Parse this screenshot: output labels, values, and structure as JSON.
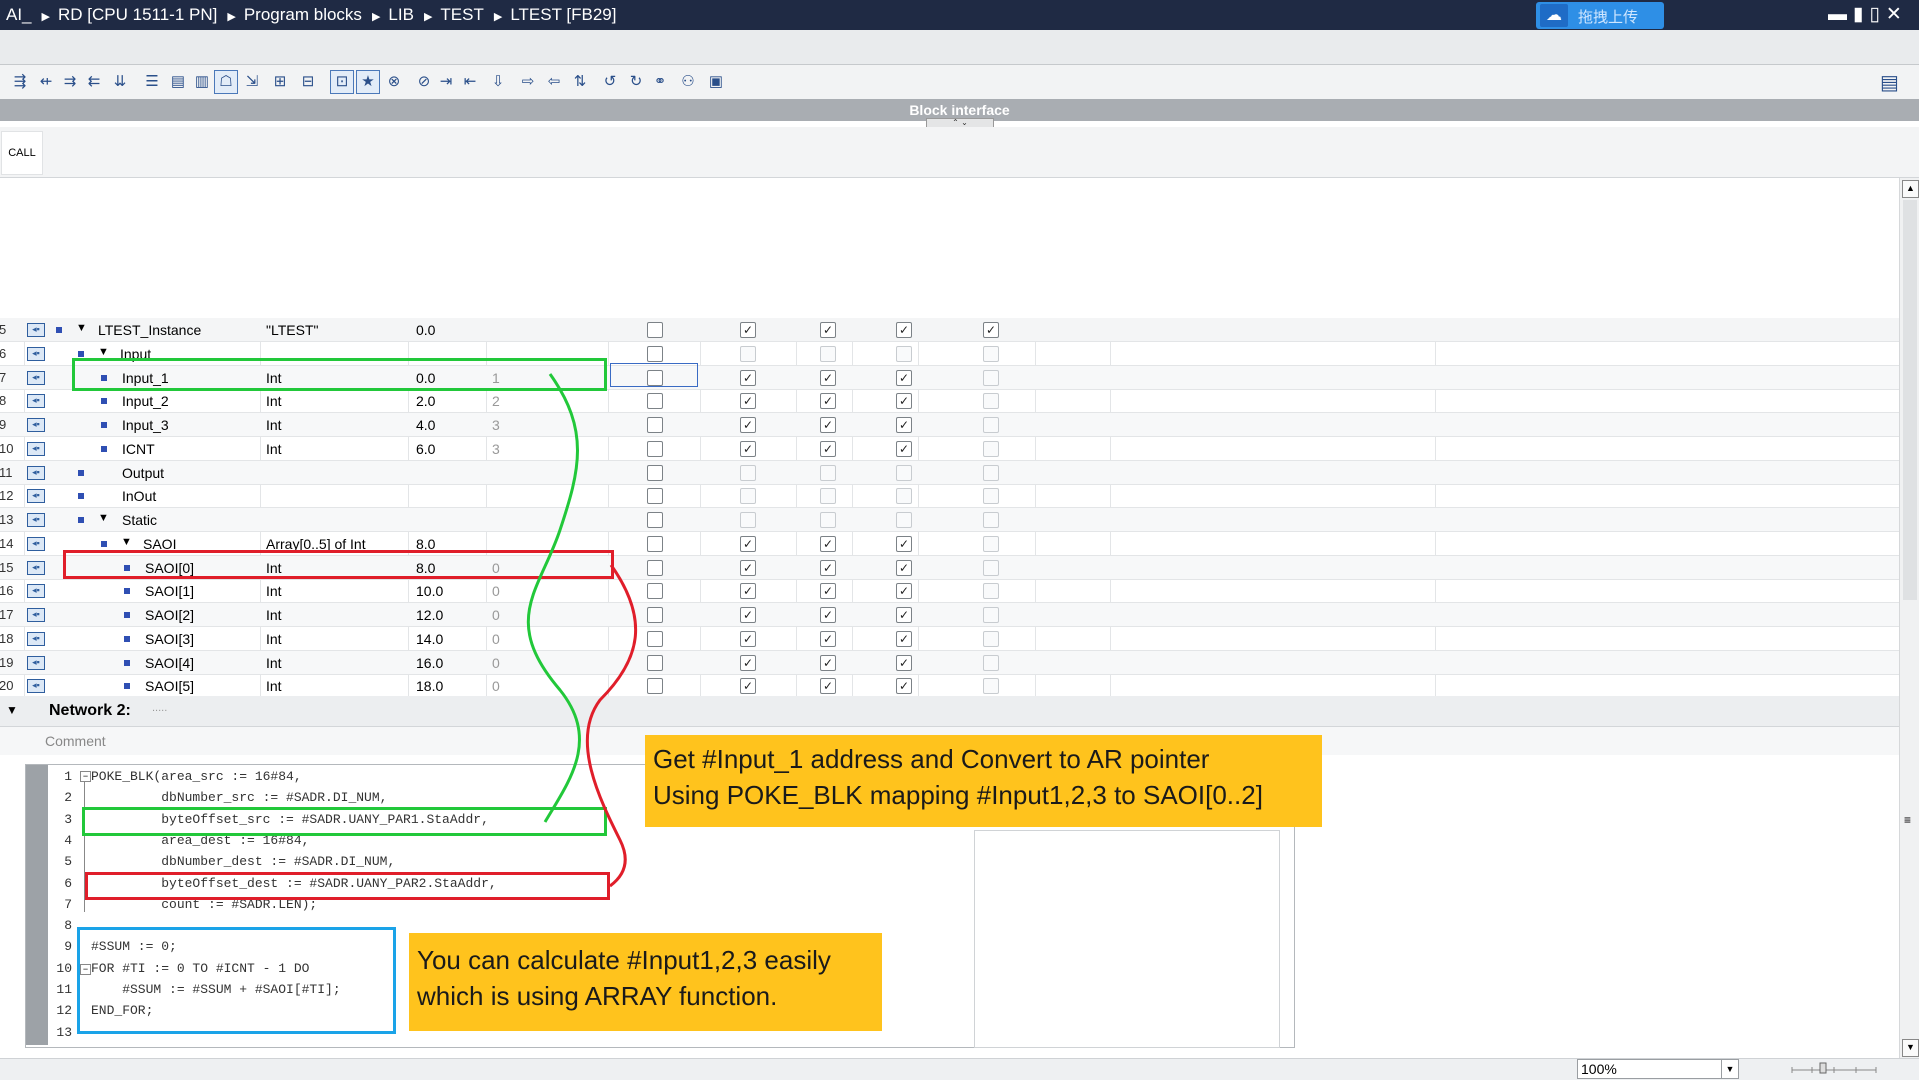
{
  "titlebar": {
    "breadcrumb": [
      "AI_",
      "RD [CPU 1511-1 PN]",
      "Program blocks",
      "LIB",
      "TEST",
      "LTEST [FB29]"
    ],
    "upload_label": "拖拽上传",
    "window_controls": "▬▮▯✕"
  },
  "toolbar": {
    "icons": [
      "insert-network-icon",
      "delete-network-icon",
      "insert-row-icon",
      "add-row-icon",
      "compile-icon",
      "list-icon",
      "list-grid-icon",
      "detail-icon",
      "comment-icon",
      "expand-icon",
      "open-all-icon",
      "close-all-icon",
      "absolute-icon",
      "favorites-icon",
      "breakpoint-set-icon",
      "breakpoint-clear-icon",
      "go-to-icon",
      "go-to-next-icon",
      "download-icon",
      "indent-icon",
      "outdent-icon",
      "sort-icon",
      "undo-icon",
      "redo-icon",
      "monitor-icon",
      "watch-icon",
      "snapshot-icon"
    ],
    "block_interface_label": "Block interface",
    "handle_label": "⌃ ⌄",
    "right_icon": "▤"
  },
  "call_tab": "CALL",
  "table": {
    "rows": [
      {
        "n": "5",
        "name": "LTEST_Instance",
        "type": "\"LTEST\"",
        "offset": "0.0",
        "start": "",
        "checks": [
          false,
          true,
          true,
          true,
          true
        ]
      },
      {
        "n": "6",
        "name": "Input",
        "type": "",
        "offset": "",
        "start": "",
        "checks": [
          false,
          false,
          false,
          false,
          false
        ]
      },
      {
        "n": "7",
        "name": "Input_1",
        "type": "Int",
        "offset": "0.0",
        "start": "1",
        "checks": [
          false,
          true,
          true,
          true,
          false
        ]
      },
      {
        "n": "8",
        "name": "Input_2",
        "type": "Int",
        "offset": "2.0",
        "start": "2",
        "checks": [
          false,
          true,
          true,
          true,
          false
        ]
      },
      {
        "n": "9",
        "name": "Input_3",
        "type": "Int",
        "offset": "4.0",
        "start": "3",
        "checks": [
          false,
          true,
          true,
          true,
          false
        ]
      },
      {
        "n": "10",
        "name": "ICNT",
        "type": "Int",
        "offset": "6.0",
        "start": "3",
        "checks": [
          false,
          true,
          true,
          true,
          false
        ]
      },
      {
        "n": "11",
        "name": "Output",
        "type": "",
        "offset": "",
        "start": "",
        "checks": [
          false,
          false,
          false,
          false,
          false
        ]
      },
      {
        "n": "12",
        "name": "InOut",
        "type": "",
        "offset": "",
        "start": "",
        "checks": [
          false,
          false,
          false,
          false,
          false
        ]
      },
      {
        "n": "13",
        "name": "Static",
        "type": "",
        "offset": "",
        "start": "",
        "checks": [
          false,
          false,
          false,
          false,
          false
        ]
      },
      {
        "n": "14",
        "name": "SAOI",
        "type": "Array[0..5] of Int",
        "offset": "8.0",
        "start": "",
        "checks": [
          false,
          true,
          true,
          true,
          false
        ]
      },
      {
        "n": "15",
        "name": "SAOI[0]",
        "type": "Int",
        "offset": "8.0",
        "start": "0",
        "checks": [
          false,
          true,
          true,
          true,
          false
        ]
      },
      {
        "n": "16",
        "name": "SAOI[1]",
        "type": "Int",
        "offset": "10.0",
        "start": "0",
        "checks": [
          false,
          true,
          true,
          true,
          false
        ]
      },
      {
        "n": "17",
        "name": "SAOI[2]",
        "type": "Int",
        "offset": "12.0",
        "start": "0",
        "checks": [
          false,
          true,
          true,
          true,
          false
        ]
      },
      {
        "n": "18",
        "name": "SAOI[3]",
        "type": "Int",
        "offset": "14.0",
        "start": "0",
        "checks": [
          false,
          true,
          true,
          true,
          false
        ]
      },
      {
        "n": "19",
        "name": "SAOI[4]",
        "type": "Int",
        "offset": "16.0",
        "start": "0",
        "checks": [
          false,
          true,
          true,
          true,
          false
        ]
      },
      {
        "n": "20",
        "name": "SAOI[5]",
        "type": "Int",
        "offset": "18.0",
        "start": "0",
        "checks": [
          false,
          true,
          true,
          true,
          false
        ]
      }
    ],
    "check_mark": "✓"
  },
  "network": {
    "title": "Network 2:",
    "title_suffix": ".....",
    "comment_placeholder": "Comment"
  },
  "code": {
    "lines": [
      "POKE_BLK(area_src := 16#84,",
      "         dbNumber_src := #SADR.DI_NUM,",
      "         byteOffset_src := #SADR.UANY_PAR1.StaAddr,",
      "         area_dest := 16#84,",
      "         dbNumber_dest := #SADR.DI_NUM,",
      "         byteOffset_dest := #SADR.UANY_PAR2.StaAddr,",
      "         count := #SADR.LEN);",
      "",
      "#SSUM := 0;",
      "FOR #TI := 0 TO #ICNT - 1 DO",
      "    #SSUM := #SSUM + #SAOI[#TI];",
      "END_FOR;",
      ""
    ]
  },
  "callouts": {
    "top": [
      "Get #Input_1 address and Convert to AR pointer",
      "Using POKE_BLK mapping #Input1,2,3 to SAOI[0..2]"
    ],
    "bottom": [
      "You can calculate #Input1,2,3 easily",
      "which is using ARRAY function."
    ]
  },
  "statusbar": {
    "zoom": "100%"
  },
  "colors": {
    "titlebar": "#1f2a44",
    "green": "#22c83a",
    "red": "#e01e2a",
    "blue": "#1aa3e8",
    "callout": "#ffc31d"
  }
}
